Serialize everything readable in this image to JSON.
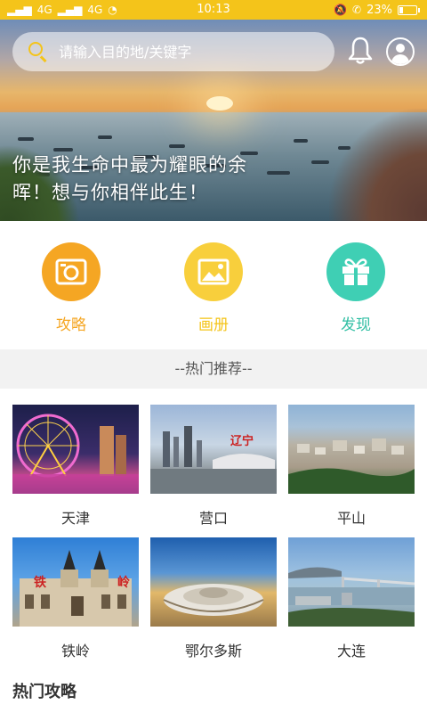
{
  "status_bar": {
    "signal1": "4G",
    "signal2": "4G",
    "time": "10:13",
    "battery": "23%",
    "battery_level": 0.23
  },
  "search": {
    "placeholder": "请输入目的地/关键字"
  },
  "hero": {
    "caption": "你是我生命中最为耀眼的余晖！想与你相伴此生！"
  },
  "categories": [
    {
      "label": "攻略",
      "icon": "camera-icon",
      "color": "#f5a623",
      "label_color": "#f5a623"
    },
    {
      "label": "画册",
      "icon": "image-icon",
      "color": "#f8cf3c",
      "label_color": "#f4c41a"
    },
    {
      "label": "发现",
      "icon": "gift-icon",
      "color": "#3fcfb4",
      "label_color": "#32bfa4"
    }
  ],
  "section_header": "--热门推荐--",
  "cities": [
    {
      "name": "天津"
    },
    {
      "name": "营口"
    },
    {
      "name": "平山"
    },
    {
      "name": "铁岭"
    },
    {
      "name": "鄂尔多斯"
    },
    {
      "name": "大连"
    }
  ],
  "city_image_text": {
    "yingkou_sign": "辽宁",
    "tieling_sign_left": "铁",
    "tieling_sign_right": "岭"
  },
  "hot_guides_title": "热门攻略",
  "colors": {
    "accent": "#f4c41a",
    "section_bg": "#f2f2f2"
  }
}
